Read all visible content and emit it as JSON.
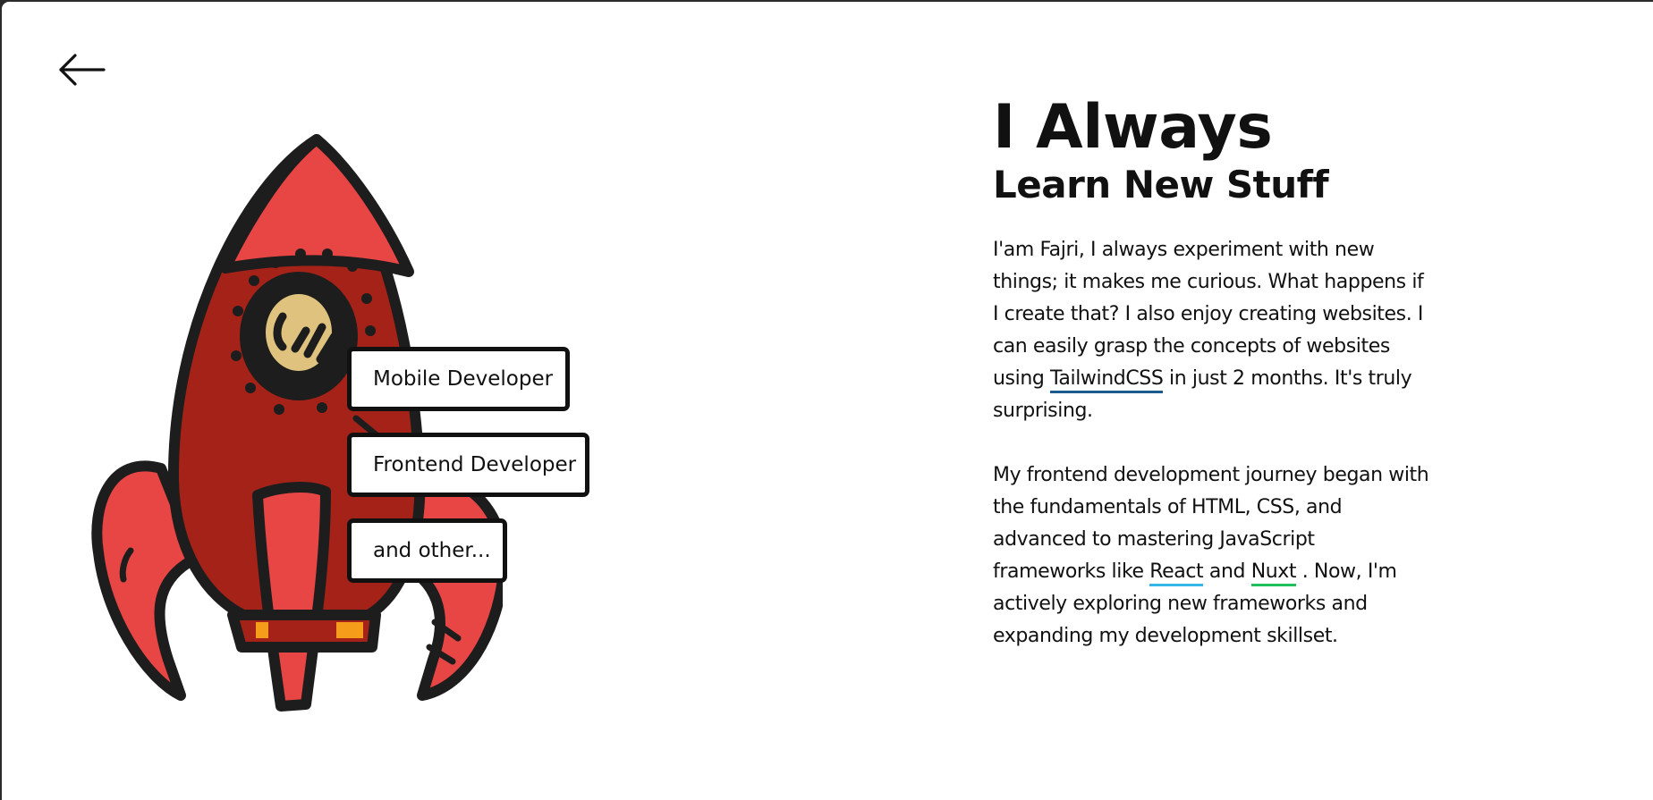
{
  "nav": {
    "back_icon": "arrow-left-icon"
  },
  "hero": {
    "illustration": "rocket-illustration",
    "roles": [
      "Mobile Developer",
      "Frontend Developer",
      "and other..."
    ]
  },
  "about": {
    "title": "I Always",
    "subtitle": "Learn New Stuff",
    "paragraph1": {
      "before_link": "I'am Fajri, I always experiment with new things; it makes me curious. What happens if I create that? I also enjoy creating websites. I can easily grasp the concepts of websites using ",
      "link": "TailwindCSS",
      "after_link": " in just 2 months. It's truly surprising."
    },
    "paragraph2": {
      "before_react": "My frontend development journey began with the fundamentals of HTML, CSS, and advanced to mastering JavaScript frameworks like ",
      "react": "React",
      "between": " and ",
      "nuxt": "Nuxt",
      "after_nuxt": " . Now, I'm actively exploring new frameworks and expanding my development skillset."
    }
  },
  "colors": {
    "tailwind_underline": "#1c5b8e",
    "react_underline": "#34b7e8",
    "nuxt_underline": "#1fbf5c",
    "rocket_red": "#e84545",
    "rocket_dark_red": "#a52218",
    "porthole": "#dfc27e"
  }
}
